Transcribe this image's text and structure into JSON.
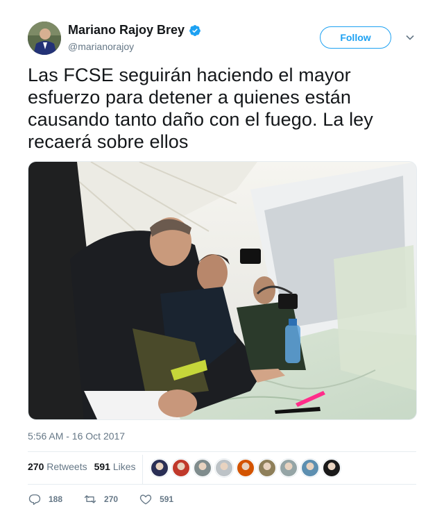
{
  "author": {
    "name": "Mariano Rajoy Brey",
    "handle": "@marianorajoy",
    "verified": true
  },
  "follow_label": "Follow",
  "tweet": {
    "text": "Las FCSE seguirán haciendo el mayor esfuerzo para detener a quienes están causando tanto daño con el fuego. La ley recaerá sobre ellos"
  },
  "timestamp": "5:56 AM - 16 Oct 2017",
  "stats": {
    "retweets_count": "270",
    "retweets_label": "Retweets",
    "likes_count": "591",
    "likes_label": "Likes"
  },
  "likers": [
    "#2a2f55",
    "#c0392b",
    "#7f8c8d",
    "#bdc3c7",
    "#d35400",
    "#8e7f5a",
    "#95a5a6",
    "#5d8fb0",
    "#1a1a1a"
  ],
  "actions": {
    "replies": "188",
    "retweets": "270",
    "likes": "591"
  },
  "colors": {
    "accent": "#1da1f2",
    "muted": "#657786",
    "text": "#14171a"
  },
  "icons": {
    "verified": "verified-badge-icon",
    "caret": "chevron-down-icon",
    "reply": "reply-icon",
    "retweet": "retweet-icon",
    "like": "heart-icon"
  }
}
